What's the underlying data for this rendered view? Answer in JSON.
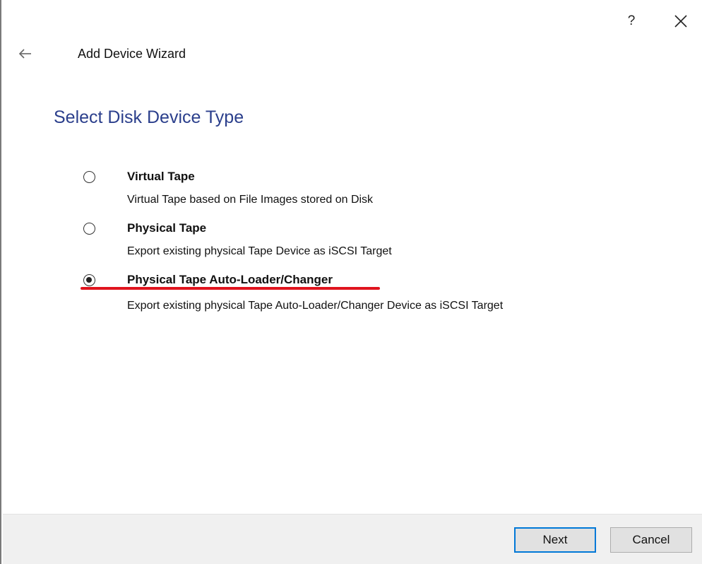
{
  "window": {
    "help_label": "?",
    "close_icon": "close-icon",
    "back_icon": "back-arrow-icon",
    "title": "Add Device Wizard"
  },
  "page": {
    "heading": "Select Disk Device Type"
  },
  "options": [
    {
      "title": "Virtual Tape",
      "description": "Virtual Tape based on File Images stored on Disk",
      "selected": false
    },
    {
      "title": "Physical Tape",
      "description": "Export existing physical Tape Device as iSCSI Target",
      "selected": false
    },
    {
      "title": "Physical Tape Auto-Loader/Changer",
      "description": "Export existing physical Tape Auto-Loader/Changer Device as iSCSI Target",
      "selected": true
    }
  ],
  "annotation": {
    "highlight_color": "#e0141e"
  },
  "footer": {
    "next_label": "Next",
    "cancel_label": "Cancel"
  },
  "colors": {
    "heading": "#2b3f8c",
    "default_button_border": "#0078d7"
  }
}
